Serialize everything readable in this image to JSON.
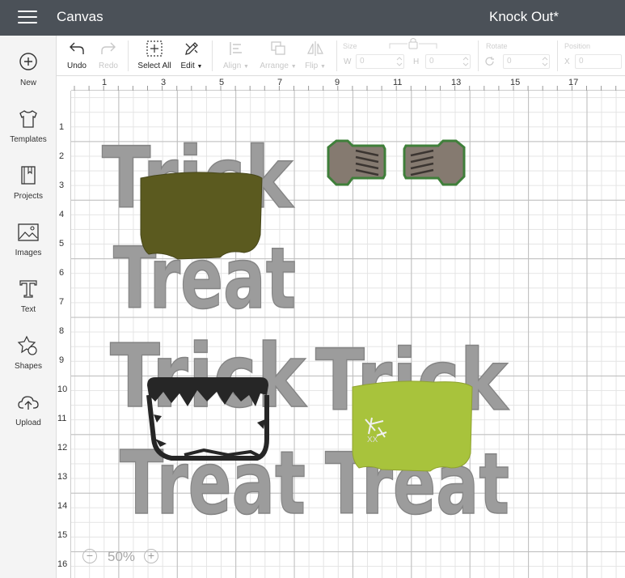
{
  "header": {
    "app_title": "Canvas",
    "doc_title": "Knock Out*"
  },
  "sidebar": {
    "items": [
      {
        "label": "New",
        "icon": "plus-circle-icon"
      },
      {
        "label": "Templates",
        "icon": "tshirt-icon"
      },
      {
        "label": "Projects",
        "icon": "notebook-icon"
      },
      {
        "label": "Images",
        "icon": "image-icon"
      },
      {
        "label": "Text",
        "icon": "text-t-icon"
      },
      {
        "label": "Shapes",
        "icon": "shapes-icon"
      },
      {
        "label": "Upload",
        "icon": "cloud-upload-icon"
      }
    ]
  },
  "toolbar": {
    "undo": "Undo",
    "redo": "Redo",
    "select_all": "Select All",
    "edit": "Edit",
    "align": "Align",
    "arrange": "Arrange",
    "flip": "Flip",
    "size_label": "Size",
    "w_label": "W",
    "h_label": "H",
    "w_value": "0",
    "h_value": "0",
    "rotate_label": "Rotate",
    "rotate_value": "0",
    "position_label": "Position",
    "x_label": "X",
    "x_value": "0"
  },
  "ruler": {
    "top": [
      "1",
      "3",
      "5",
      "7",
      "9",
      "11",
      "13",
      "15",
      "17"
    ],
    "left": [
      "1",
      "2",
      "3",
      "4",
      "5",
      "6",
      "7",
      "8",
      "9",
      "10",
      "11",
      "12",
      "13",
      "14",
      "15",
      "16"
    ]
  },
  "designs": {
    "word_trick": "Trick",
    "word_treat": "Treat",
    "stitch_text": "XX",
    "colors": {
      "olive_head": "#5b5a1f",
      "lime_head": "#a8c33c",
      "hair_black": "#262626",
      "bolt_body": "#857a70",
      "bolt_outline": "#3f7f3a",
      "text_gray": "#9c9c9c"
    }
  },
  "zoom": {
    "minus": "−",
    "value": "50%",
    "plus": "+"
  }
}
